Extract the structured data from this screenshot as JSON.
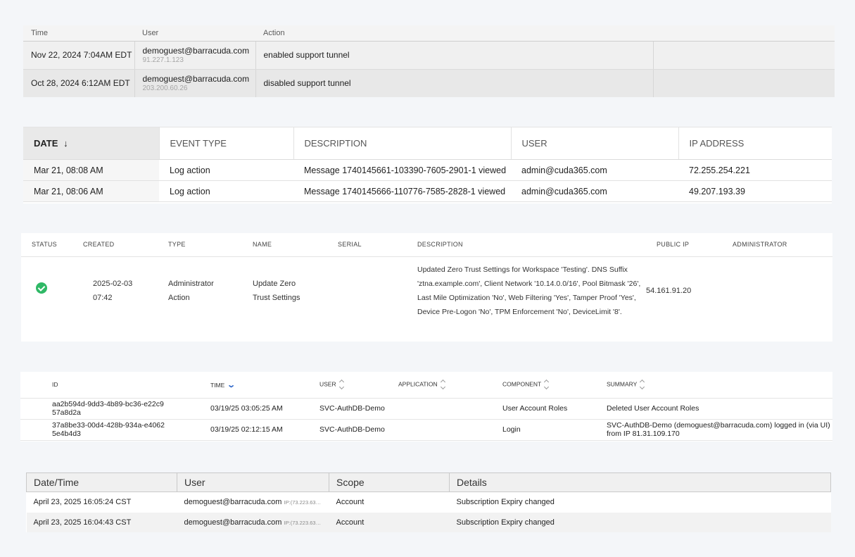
{
  "panel1": {
    "headers": [
      "Time",
      "User",
      "Action"
    ],
    "rows": [
      {
        "time": "Nov 22, 2024 7:04AM EDT",
        "user": "demoguest@barracuda.com",
        "ip": "91.227.1.123",
        "action": "enabled support tunnel"
      },
      {
        "time": "Oct 28, 2024 6:12AM EDT",
        "user": "demoguest@barracuda.com",
        "ip": "203.200.60.26",
        "action": "disabled support tunnel"
      }
    ]
  },
  "panel2": {
    "headers": [
      "DATE",
      "EVENT TYPE",
      "DESCRIPTION",
      "USER",
      "IP ADDRESS"
    ],
    "sort_arrow": "↓",
    "rows": [
      {
        "date": "Mar 21, 08:08 AM",
        "event_type": "Log action",
        "description": "Message 1740145661-103390-7605-2901-1 viewed",
        "user": "admin@cuda365.com",
        "ip": "72.255.254.221"
      },
      {
        "date": "Mar 21, 08:06 AM",
        "event_type": "Log action",
        "description": "Message 1740145666-110776-7585-2828-1 viewed",
        "user": "admin@cuda365.com",
        "ip": "49.207.193.39"
      }
    ]
  },
  "panel3": {
    "headers": [
      "STATUS",
      "CREATED",
      "TYPE",
      "NAME",
      "SERIAL",
      "DESCRIPTION",
      "PUBLIC IP",
      "ADMINISTRATOR"
    ],
    "row": {
      "status_icon": "success-check-icon",
      "status_color": "#2fb866",
      "created_date": "2025-02-03",
      "created_time": "07:42",
      "type_line1": "Administrator",
      "type_line2": "Action",
      "name_line1": "Update Zero",
      "name_line2": "Trust Settings",
      "serial": "",
      "description": "Updated Zero Trust Settings for Workspace 'Testing'. DNS Suffix 'ztna.example.com', Client Network '10.14.0.0/16', Pool Bitmask '26', Last Mile Optimization 'No', Web Filtering 'Yes', Tamper Proof 'Yes', Device Pre-Logon 'No', TPM Enforcement 'No', DeviceLimit '8'.",
      "public_ip": "54.161.91.20",
      "administrator": ""
    }
  },
  "panel4": {
    "headers": [
      "ID",
      "TIME",
      "USER",
      "APPLICATION",
      "COMPONENT",
      "SUMMARY"
    ],
    "rows": [
      {
        "id": "aa2b594d-9dd3-4b89-bc36-e22c957a8d2a",
        "time": "03/19/25 03:05:25 AM",
        "user": "SVC-AuthDB-Demo",
        "application": "",
        "component": "User Account Roles",
        "summary": "Deleted User Account Roles"
      },
      {
        "id": "37a8be33-00d4-428b-934a-e40625e4b4d3",
        "time": "03/19/25 02:12:15 AM",
        "user": "SVC-AuthDB-Demo",
        "application": "",
        "component": "Login",
        "summary": "SVC-AuthDB-Demo (demoguest@barracuda.com) logged in (via UI) from IP 81.31.109.170"
      }
    ]
  },
  "panel5": {
    "headers": [
      "Date/Time",
      "User",
      "Scope",
      "Details"
    ],
    "rows": [
      {
        "datetime": "April 23, 2025 16:05:24 CST",
        "user": "demoguest@barracuda.com",
        "ip": "IP:(73.223.63…",
        "scope": "Account",
        "details": "Subscription Expiry changed"
      },
      {
        "datetime": "April 23, 2025 16:04:43 CST",
        "user": "demoguest@barracuda.com",
        "ip": "IP:(73.223.63…",
        "scope": "Account",
        "details": "Subscription Expiry changed"
      }
    ]
  }
}
